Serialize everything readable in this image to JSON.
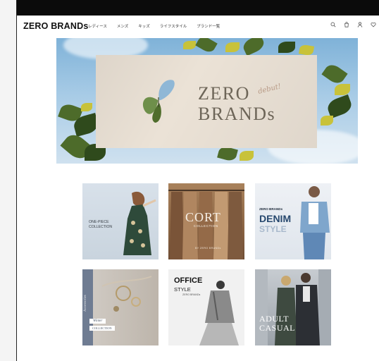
{
  "header": {
    "logo": "ZERO BRANDs",
    "nav": [
      "レディース",
      "メンズ",
      "キッズ",
      "ライフスタイル",
      "ブランド一覧"
    ]
  },
  "icons": [
    "search-icon",
    "cart-icon",
    "user-icon",
    "heart-icon"
  ],
  "hero": {
    "title_line1": "ZERO",
    "title_line2": "BRANDs",
    "script": "debut!"
  },
  "categories": [
    {
      "line1": "ONE-PIECE",
      "line2": "COLLECTION"
    },
    {
      "line1": "CORT",
      "line2": "COLLECTION",
      "line3": "BY ZERO BRANDs"
    },
    {
      "line1": "ZERO BRANDs",
      "line2": "DENIM",
      "line3": "STYLE"
    },
    {
      "line1": "Accessories",
      "line2": "Winter",
      "line3": "COLLECTION"
    },
    {
      "line1": "OFFICE",
      "line2": "STYLE",
      "line3": "ZERO BRANDs"
    },
    {
      "line1": "ADULT",
      "line2": "CASUAL"
    }
  ]
}
